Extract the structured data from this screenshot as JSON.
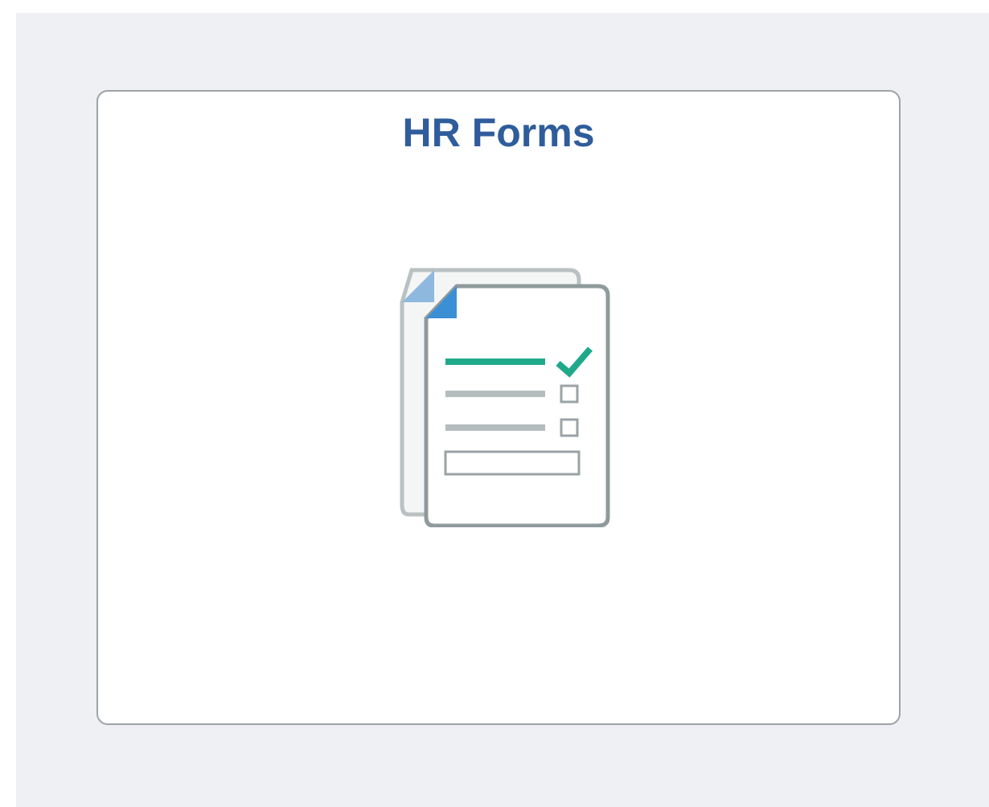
{
  "tile": {
    "title": "HR Forms"
  }
}
